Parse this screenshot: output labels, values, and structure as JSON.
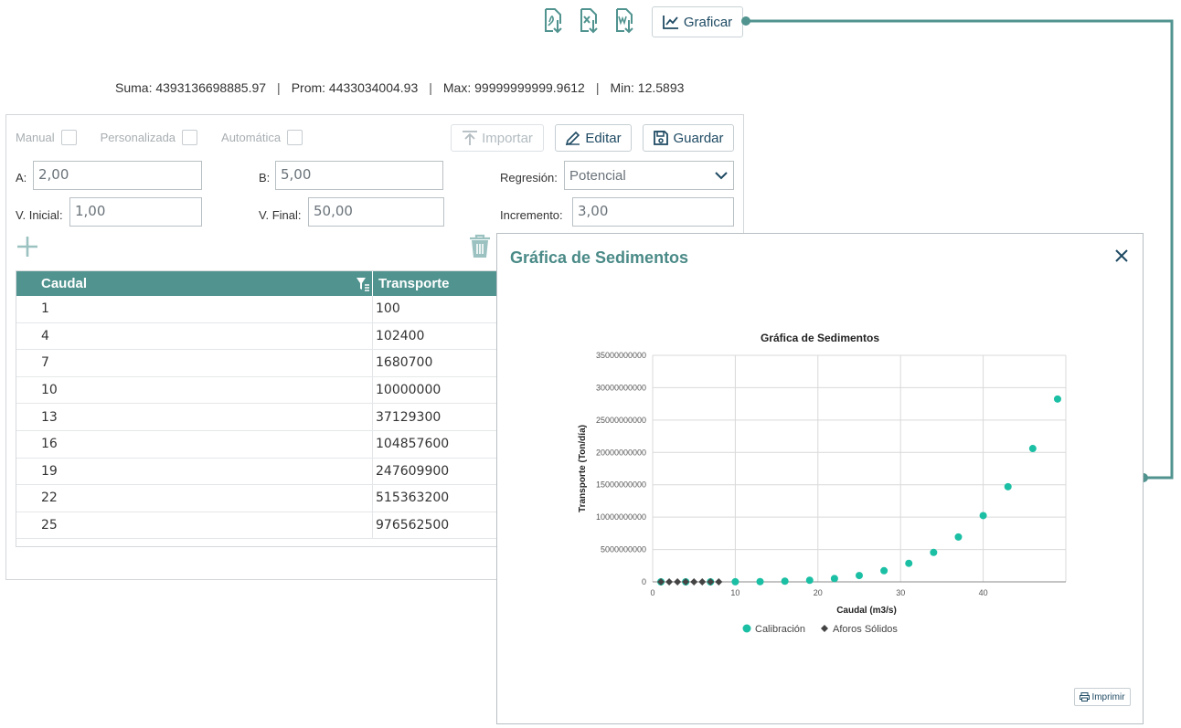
{
  "toolbar": {
    "export_icons": [
      "pdf-export-icon",
      "excel-export-icon",
      "word-export-icon"
    ],
    "graficar_label": "Graficar"
  },
  "stats": {
    "suma_label": "Suma:",
    "suma_value": "4393136698885.97",
    "prom_label": "Prom:",
    "prom_value": "4433034004.93",
    "max_label": "Max:",
    "max_value": "99999999999.9612",
    "min_label": "Min:",
    "min_value": "12.5893"
  },
  "mode": {
    "manual": "Manual",
    "personalizada": "Personalizada",
    "automatica": "Automática"
  },
  "actions": {
    "importar": "Importar",
    "editar": "Editar",
    "guardar": "Guardar"
  },
  "form": {
    "a_label": "A:",
    "a_value": "2,00",
    "b_label": "B:",
    "b_value": "5,00",
    "regresion_label": "Regresión:",
    "regresion_value": "Potencial",
    "vinicial_label": "V. Inicial:",
    "vinicial_value": "1,00",
    "vfinal_label": "V. Final:",
    "vfinal_value": "50,00",
    "incremento_label": "Incremento:",
    "incremento_value": "3,00"
  },
  "table": {
    "columns": [
      "Caudal",
      "Transporte"
    ],
    "rows": [
      [
        "1",
        "100"
      ],
      [
        "4",
        "102400"
      ],
      [
        "7",
        "1680700"
      ],
      [
        "10",
        "10000000"
      ],
      [
        "13",
        "37129300"
      ],
      [
        "16",
        "104857600"
      ],
      [
        "19",
        "247609900"
      ],
      [
        "22",
        "515363200"
      ],
      [
        "25",
        "976562500"
      ]
    ]
  },
  "modal": {
    "title": "Gráfica de Sedimentos",
    "print_label": "Imprimir"
  },
  "colors": {
    "teal": "#50938f",
    "accent": "#1e4a63",
    "calibracion": "#1bbfa4",
    "aforos": "#444444"
  },
  "chart_data": {
    "type": "scatter",
    "title": "Gráfica de Sedimentos",
    "xlabel": "Caudal (m3/s)",
    "ylabel": "Transporte (Ton/día)",
    "xlim": [
      0,
      50
    ],
    "ylim": [
      0,
      35000000000
    ],
    "xticks": [
      "0",
      "10",
      "20",
      "30",
      "40"
    ],
    "yticks": [
      "0",
      "5000000000",
      "10000000000",
      "15000000000",
      "20000000000",
      "25000000000",
      "30000000000",
      "35000000000"
    ],
    "grid": true,
    "legend": "bottom",
    "series": [
      {
        "name": "Calibración",
        "marker": "circle",
        "x": [
          1,
          4,
          7,
          10,
          13,
          16,
          19,
          22,
          25,
          28,
          31,
          34,
          37,
          40,
          43,
          46,
          49
        ],
        "y": [
          100,
          102400,
          1680700,
          10000000,
          37129300,
          104857600,
          247609900,
          515363200,
          976562500,
          1721036800,
          2862915100,
          4543542400,
          6934395700,
          10240000000,
          14700924300,
          20596297600,
          28247524900
        ]
      },
      {
        "name": "Aforos Sólidos",
        "marker": "diamond",
        "x": [
          1,
          2,
          3,
          4,
          5,
          6,
          7,
          8
        ],
        "y": [
          0,
          0,
          0,
          0,
          0,
          0,
          0,
          0
        ]
      }
    ]
  }
}
